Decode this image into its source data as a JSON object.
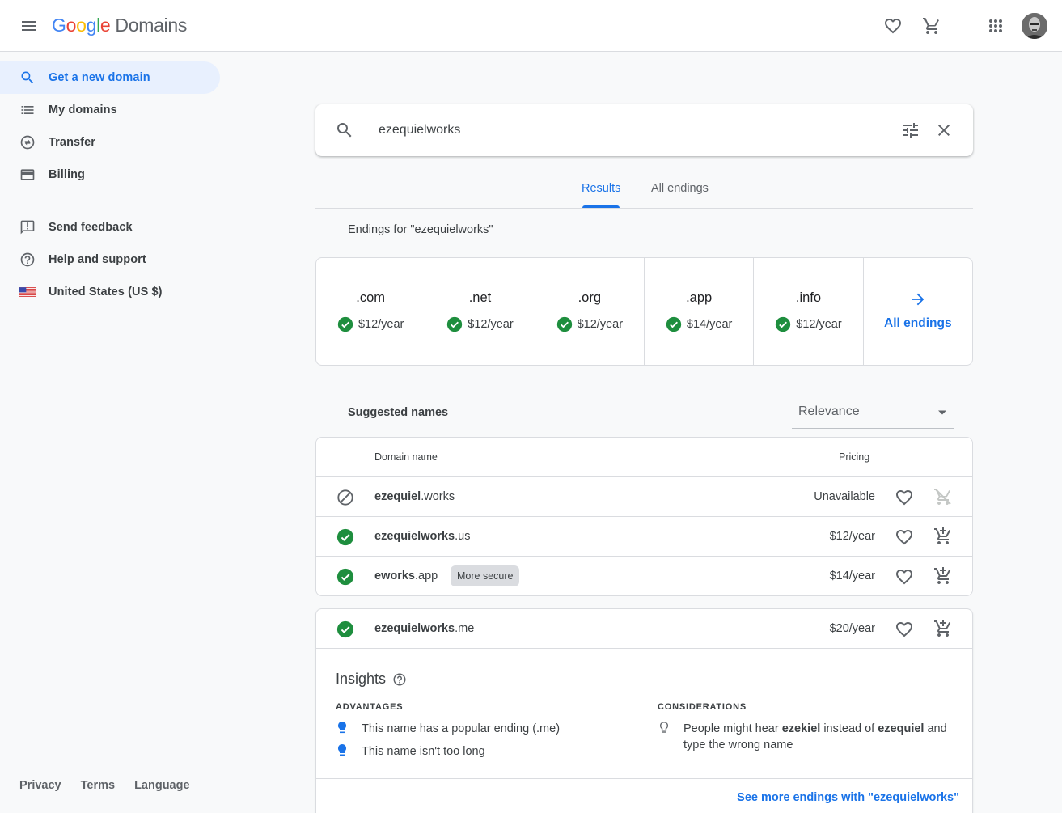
{
  "header": {
    "logo_letters": [
      "G",
      "o",
      "o",
      "g",
      "l",
      "e"
    ],
    "product_name": "Domains",
    "icons": [
      "menu-icon",
      "heart-icon",
      "cart-icon",
      "apps-grid-icon",
      "account-avatar"
    ]
  },
  "sidebar": {
    "items": [
      {
        "label": "Get a new domain",
        "icon": "search-icon",
        "active": true
      },
      {
        "label": "My domains",
        "icon": "list-icon",
        "active": false
      },
      {
        "label": "Transfer",
        "icon": "transfer-icon",
        "active": false
      },
      {
        "label": "Billing",
        "icon": "credit-card-icon",
        "active": false
      }
    ],
    "secondary_items": [
      {
        "label": "Send feedback",
        "icon": "feedback-icon"
      },
      {
        "label": "Help and support",
        "icon": "help-icon"
      },
      {
        "label": "United States (US $)",
        "icon": "us-flag-icon"
      }
    ],
    "footer_links": [
      "Privacy",
      "Terms",
      "Language"
    ]
  },
  "search": {
    "value": "ezequielworks",
    "placeholder": ""
  },
  "tabs": [
    {
      "label": "Results",
      "active": true
    },
    {
      "label": "All endings",
      "active": false
    }
  ],
  "endings": {
    "title": "Endings for \"ezequielworks\"",
    "items": [
      {
        "tld": ".com",
        "price": "$12/year",
        "available": true
      },
      {
        "tld": ".net",
        "price": "$12/year",
        "available": true
      },
      {
        "tld": ".org",
        "price": "$12/year",
        "available": true
      },
      {
        "tld": ".app",
        "price": "$14/year",
        "available": true
      },
      {
        "tld": ".info",
        "price": "$12/year",
        "available": true
      }
    ],
    "all_label": "All endings"
  },
  "suggested": {
    "title": "Suggested names",
    "sort": {
      "selected": "Relevance"
    },
    "columns": [
      "Domain name",
      "Pricing"
    ],
    "rows": [
      {
        "name_bold": "ezequiel",
        "name_tld": ".works",
        "badge": null,
        "price": "Unavailable",
        "available": false
      },
      {
        "name_bold": "ezequielworks",
        "name_tld": ".us",
        "badge": null,
        "price": "$12/year",
        "available": true
      },
      {
        "name_bold": "eworks",
        "name_tld": ".app",
        "badge": "More secure",
        "price": "$14/year",
        "available": true
      }
    ]
  },
  "expanded": {
    "row": {
      "name_bold": "ezequielworks",
      "name_tld": ".me",
      "price": "$20/year",
      "available": true
    },
    "insights_title": "Insights",
    "advantages_heading": "ADVANTAGES",
    "advantages": [
      "This name has a popular ending (.me)",
      "This name isn't too long"
    ],
    "considerations_heading": "CONSIDERATIONS",
    "considerations": [
      {
        "pre": "People might hear ",
        "b1": "ezekiel",
        "mid": " instead of ",
        "b2": "ezequiel",
        "post": " and type the wrong name"
      }
    ],
    "see_more": "See more endings with \"ezequielworks\""
  },
  "colors": {
    "accent": "#1a73e8",
    "available_green": "#1e8e3e",
    "active_nav_bg": "#e8f0fe",
    "page_bg": "#f8f9fa"
  }
}
